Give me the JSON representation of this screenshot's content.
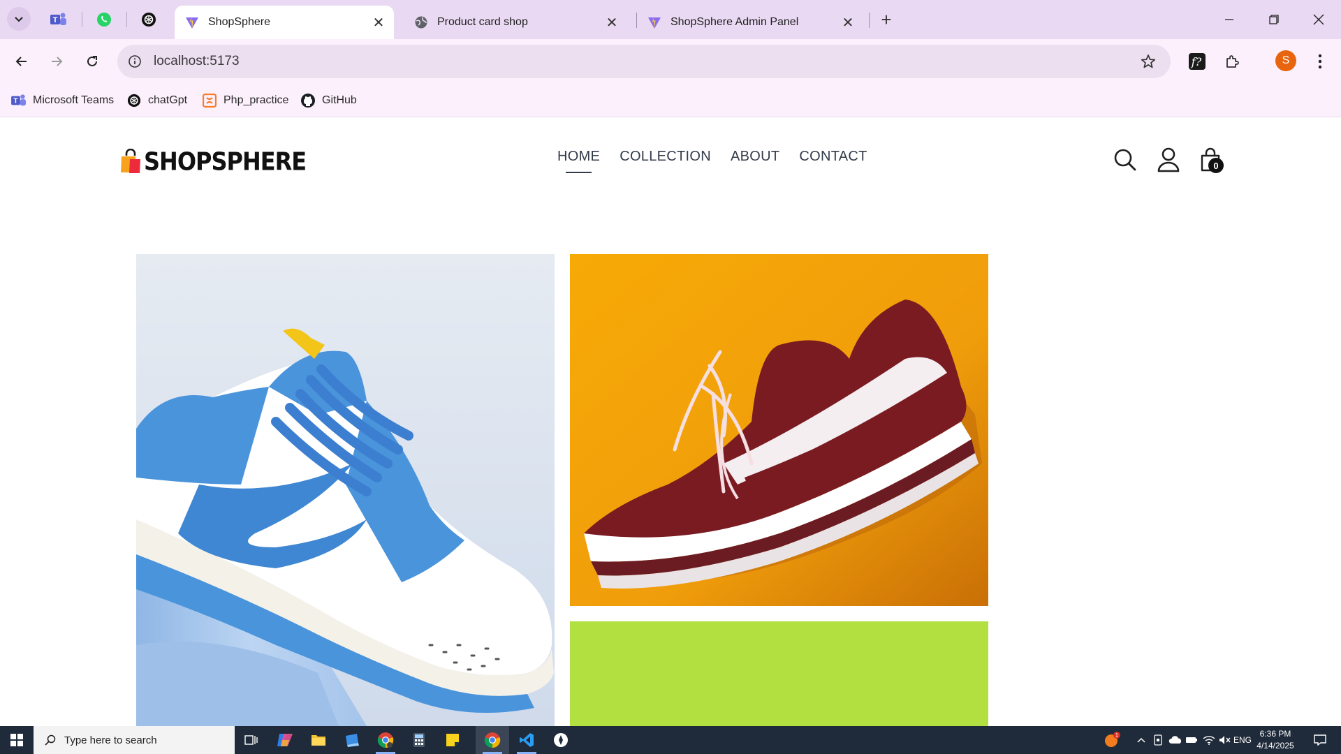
{
  "browser": {
    "tabs": [
      {
        "title": "ShopSphere",
        "active": true
      },
      {
        "title": "Product card shop",
        "active": false
      },
      {
        "title": "ShopSphere Admin Panel",
        "active": false
      }
    ],
    "pinned_tabs": [
      "teams-icon",
      "whatsapp-icon",
      "chatgpt-icon"
    ],
    "address": "localhost:5173",
    "profile_initial": "S",
    "bookmarks": [
      {
        "label": "Microsoft Teams",
        "icon": "teams-icon"
      },
      {
        "label": "chatGpt",
        "icon": "chatgpt-icon"
      },
      {
        "label": "Php_practice",
        "icon": "xampp-icon"
      },
      {
        "label": "GitHub",
        "icon": "github-icon"
      }
    ]
  },
  "site": {
    "brand": "SHOPSPHERE",
    "nav": [
      "HOME",
      "COLLECTION",
      "ABOUT",
      "CONTACT"
    ],
    "active_nav": "HOME",
    "cart_count": "0",
    "colors": {
      "text": "#333b4a",
      "orange_bg": "#f3a30a",
      "lime_bg": "#b2e041",
      "blue_bg": "#dfe7f3"
    }
  },
  "taskbar": {
    "search_placeholder": "Type here to search",
    "language": "ENG",
    "time": "6:36 PM",
    "date": "4/14/2025",
    "notification_count": "1"
  }
}
